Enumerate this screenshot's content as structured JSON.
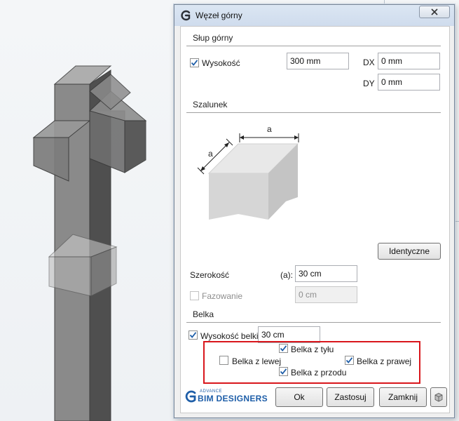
{
  "dialog": {
    "title": "Węzeł górny",
    "sections": {
      "slup_gorny": "Słup górny",
      "szalunek": "Szalunek",
      "belka": "Belka"
    },
    "slup": {
      "wysokosc_label": "Wysokość",
      "wysokosc_checked": true,
      "wysokosc_value": "300 mm",
      "dx_label": "DX",
      "dx_value": "0 mm",
      "dy_label": "DY",
      "dy_value": "0 mm"
    },
    "szalunek": {
      "dim_label_top": "a",
      "dim_label_side": "a",
      "identyczne_button": "Identyczne",
      "szerokosc_label": "Szerokość",
      "a_label": "(a):",
      "szerokosc_value": "30 cm",
      "fazowanie_label": "Fazowanie",
      "fazowanie_checked": false,
      "fazowanie_value": "0 cm"
    },
    "belka": {
      "wysokosc_belki_label": "Wysokość belki",
      "wysokosc_belki_checked": true,
      "wysokosc_belki_value": "30 cm",
      "z_tylu_label": "Belka z tyłu",
      "z_tylu_checked": true,
      "z_lewej_label": "Belka z lewej",
      "z_lewej_checked": false,
      "z_prawej_label": "Belka z prawej",
      "z_prawej_checked": true,
      "z_przodu_label": "Belka z przodu",
      "z_przodu_checked": true
    },
    "footer": {
      "brand_small": "ADVANCE",
      "brand_text": "BIM DESIGNERS",
      "ok_button": "Ok",
      "apply_button": "Zastosuj",
      "close_button": "Zamknij"
    },
    "colors": {
      "highlight": "#d9161c",
      "accent": "#1e5ea8"
    }
  }
}
